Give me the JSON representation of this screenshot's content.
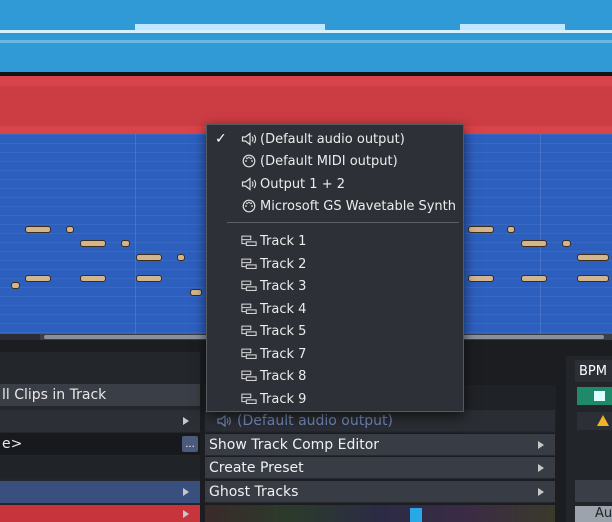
{
  "dropdown": {
    "outputs": [
      {
        "label": "(Default audio output)",
        "icon": "speaker-icon",
        "checked": true
      },
      {
        "label": "(Default MIDI output)",
        "icon": "midi-icon",
        "checked": false
      },
      {
        "label": "Output 1 + 2",
        "icon": "speaker-icon",
        "checked": false
      },
      {
        "label": "Microsoft GS Wavetable Synth",
        "icon": "midi-icon",
        "checked": false
      }
    ],
    "tracks": [
      {
        "label": "Track 1",
        "icon": "track-icon"
      },
      {
        "label": "Track 2",
        "icon": "track-icon"
      },
      {
        "label": "Track 3",
        "icon": "track-icon"
      },
      {
        "label": "Track 4",
        "icon": "track-icon"
      },
      {
        "label": "Track 5",
        "icon": "track-icon"
      },
      {
        "label": "Track 7",
        "icon": "track-icon"
      },
      {
        "label": "Track 8",
        "icon": "track-icon"
      },
      {
        "label": "Track 9",
        "icon": "track-icon"
      }
    ],
    "check_glyph": "✓"
  },
  "left_menu": {
    "clips_item": "ll Clips in Track",
    "value_item": "e>",
    "dots": "..."
  },
  "sub_menu": {
    "current_output": "(Default audio output)",
    "items": [
      "Show Track Comp Editor",
      "Create Preset",
      "Ghost Tracks"
    ]
  },
  "right_panel": {
    "bpm_label": "BPM",
    "auto_label": "Au"
  },
  "colors": {
    "audio_lane": "#2f9ad6",
    "midi_red_lane": "#d9434a",
    "midi_blue_lane": "#2d5fbf",
    "note": "#d2b58d",
    "menu_bg": "#2d3036"
  }
}
